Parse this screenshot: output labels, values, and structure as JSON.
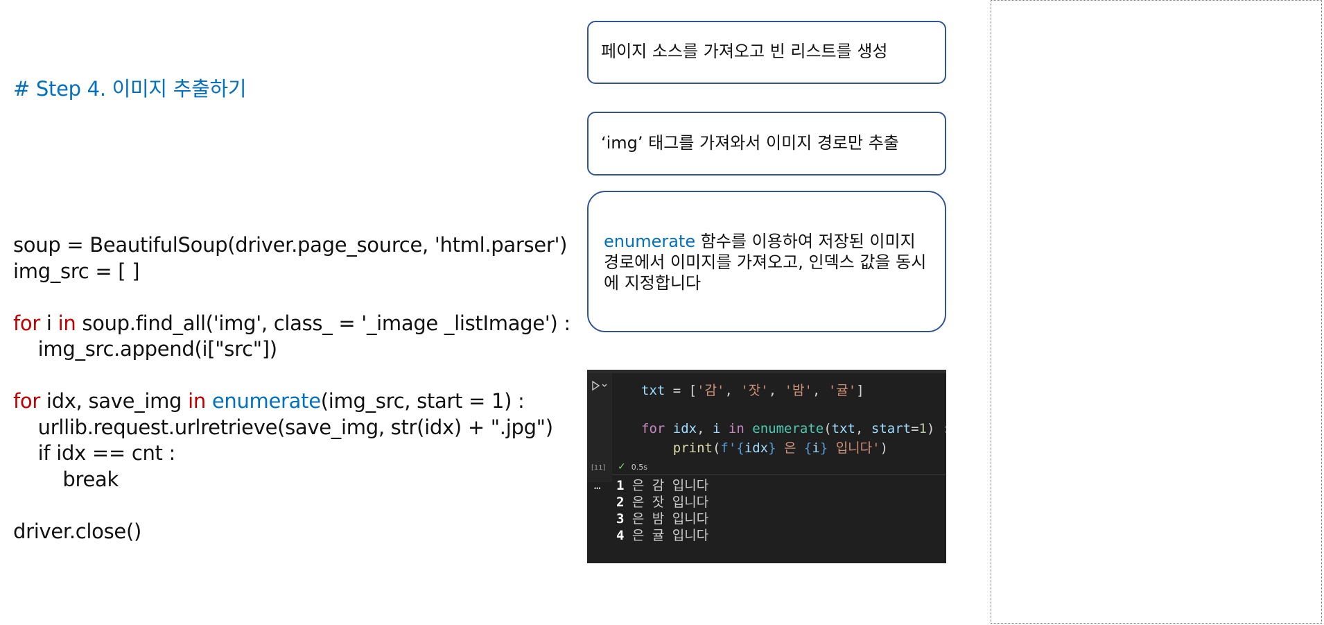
{
  "code": {
    "heading": "# Step 4. 이미지 추출하기",
    "lines": [
      {
        "parts": [
          {
            "t": "soup = BeautifulSoup(driver.page_source, 'html.parser')",
            "c": ""
          }
        ]
      },
      {
        "parts": [
          {
            "t": "img_src = [ ]",
            "c": ""
          }
        ]
      },
      {
        "parts": []
      },
      {
        "parts": [
          {
            "t": "for",
            "c": "kw-red"
          },
          {
            "t": " i ",
            "c": ""
          },
          {
            "t": "in",
            "c": "kw-red"
          },
          {
            "t": " soup.find_all('img', class_ = '_image _listImage') :",
            "c": ""
          }
        ]
      },
      {
        "parts": [
          {
            "t": "    img_src.append(i[\"src\"])",
            "c": ""
          }
        ]
      },
      {
        "parts": []
      },
      {
        "parts": [
          {
            "t": "for",
            "c": "kw-red"
          },
          {
            "t": " idx, save_img ",
            "c": ""
          },
          {
            "t": "in",
            "c": "kw-red"
          },
          {
            "t": " ",
            "c": ""
          },
          {
            "t": "enumerate",
            "c": "kw-blue"
          },
          {
            "t": "(img_src, start = 1) :",
            "c": ""
          }
        ]
      },
      {
        "parts": [
          {
            "t": "    urllib.request.urlretrieve(save_img, str(idx) + \".jpg\")",
            "c": ""
          }
        ]
      },
      {
        "parts": [
          {
            "t": "    if idx == cnt :",
            "c": ""
          }
        ]
      },
      {
        "parts": [
          {
            "t": "        break",
            "c": ""
          }
        ]
      },
      {
        "parts": []
      },
      {
        "parts": [
          {
            "t": "driver.close()",
            "c": ""
          }
        ]
      }
    ]
  },
  "callouts": {
    "c1": "페이지 소스를 가져오고 빈 리스트를 생성",
    "c2": "‘img’ 태그를 가져와서 이미지 경로만 추출",
    "c3_keyword": "enumerate",
    "c3_rest": " 함수를 이용하여 저장된 이미지 경로에서 이미지를 가져오고, 인덱스 값을 동시에 지정합니다"
  },
  "notebook": {
    "exec_count": "[11]",
    "status_time": "0.5s",
    "more_icon": "…",
    "code_lines": [
      [
        {
          "t": "txt",
          "c": "t-var"
        },
        {
          "t": " = [",
          "c": "t-punc"
        },
        {
          "t": "'감'",
          "c": "t-str"
        },
        {
          "t": ", ",
          "c": "t-punc"
        },
        {
          "t": "'잣'",
          "c": "t-str"
        },
        {
          "t": ", ",
          "c": "t-punc"
        },
        {
          "t": "'밤'",
          "c": "t-str"
        },
        {
          "t": ", ",
          "c": "t-punc"
        },
        {
          "t": "'귤'",
          "c": "t-str"
        },
        {
          "t": "]",
          "c": "t-punc"
        }
      ],
      [],
      [
        {
          "t": "for",
          "c": "t-kw"
        },
        {
          "t": " ",
          "c": "t-punc"
        },
        {
          "t": "idx",
          "c": "t-var"
        },
        {
          "t": ", ",
          "c": "t-punc"
        },
        {
          "t": "i",
          "c": "t-var"
        },
        {
          "t": " ",
          "c": "t-punc"
        },
        {
          "t": "in",
          "c": "t-kw"
        },
        {
          "t": " ",
          "c": "t-punc"
        },
        {
          "t": "enumerate",
          "c": "t-fn"
        },
        {
          "t": "(",
          "c": "t-punc"
        },
        {
          "t": "txt",
          "c": "t-var"
        },
        {
          "t": ", ",
          "c": "t-punc"
        },
        {
          "t": "start",
          "c": "t-var"
        },
        {
          "t": "=",
          "c": "t-punc"
        },
        {
          "t": "1",
          "c": "t-num"
        },
        {
          "t": ") :",
          "c": "t-punc"
        }
      ],
      [
        {
          "t": "    ",
          "c": "t-punc"
        },
        {
          "t": "print",
          "c": "t-fn2"
        },
        {
          "t": "(",
          "c": "t-punc"
        },
        {
          "t": "f'",
          "c": "t-brace"
        },
        {
          "t": "{",
          "c": "t-brace"
        },
        {
          "t": "idx",
          "c": "t-var"
        },
        {
          "t": "}",
          "c": "t-brace"
        },
        {
          "t": " 은 ",
          "c": "t-str"
        },
        {
          "t": "{",
          "c": "t-brace"
        },
        {
          "t": "i",
          "c": "t-var"
        },
        {
          "t": "}",
          "c": "t-brace"
        },
        {
          "t": " 입니다'",
          "c": "t-str"
        },
        {
          "t": ")",
          "c": "t-punc"
        }
      ]
    ],
    "output": [
      {
        "idx": "1",
        "text": " 은 감 입니다"
      },
      {
        "idx": "2",
        "text": " 은 잣 입니다"
      },
      {
        "idx": "3",
        "text": " 은 밤 입니다"
      },
      {
        "idx": "4",
        "text": " 은 귤 입니다"
      }
    ]
  }
}
